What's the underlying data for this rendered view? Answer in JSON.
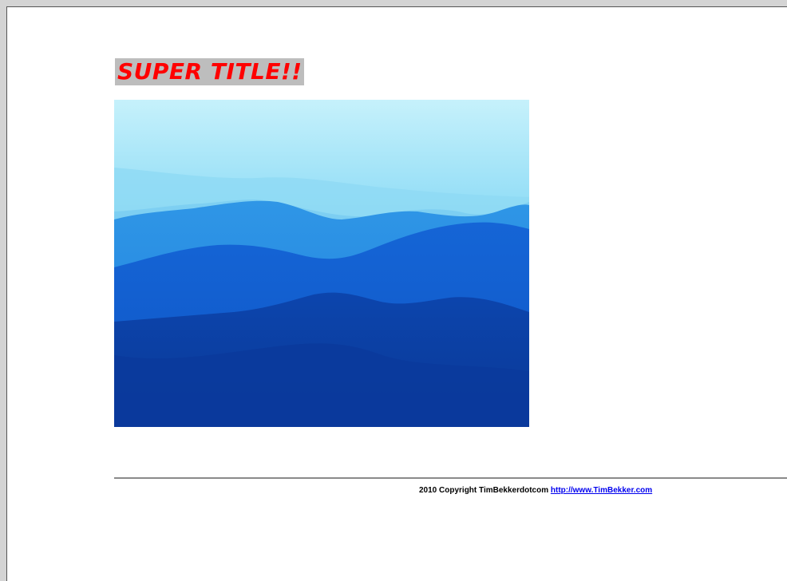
{
  "page": {
    "title": "SUPER TITLE!!",
    "image": {
      "subject": "blue-mountain-ranges"
    },
    "footer": {
      "copyright_text": "2010 Copyright TimBekkerdotcom",
      "link_text": "http://www.TimBekker.com"
    }
  },
  "colors": {
    "title_text": "#ff0000",
    "title_highlight": "#bdbdbd",
    "link": "#0000ee",
    "sky_top": "#c9f1fb",
    "mountain_far": "#3fa7ea",
    "mountain_mid": "#0f5fd6",
    "mountain_near": "#0a3fa6"
  }
}
